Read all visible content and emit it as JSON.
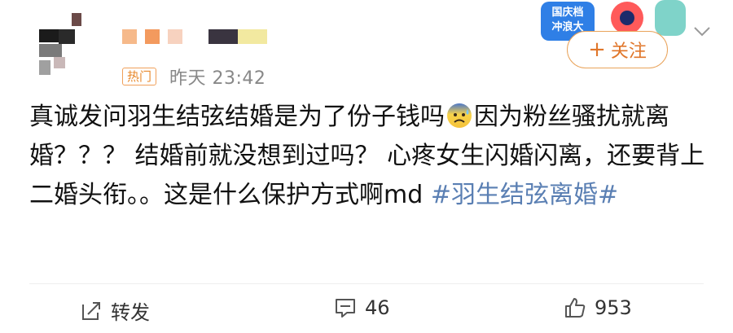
{
  "post": {
    "hot_badge": "热门",
    "timestamp": "昨天 23:42",
    "text_part1": "真诚发问羽生结弦结婚是为了份子钱吗",
    "emoji_name": "anxious-sweat-face",
    "text_part2": "因为粉丝骚扰就离婚？？？ 结婚前就没想到过吗？ 心疼女生闪婚闪离，还要背上二婚头衔。。这是什么保护方式啊md ",
    "hashtag": "#羽生结弦离婚#"
  },
  "header": {
    "campaign_label_line1": "国庆档",
    "campaign_label_line2": "冲浪大",
    "follow_label": "关注",
    "follow_plus": "+"
  },
  "actions": {
    "forward_label": "转发",
    "comment_count": "46",
    "like_count": "953"
  },
  "colors": {
    "accent_orange": "#e0762a",
    "hashtag_blue": "#5a7fb3",
    "hot_badge_border": "#f0a05a"
  }
}
